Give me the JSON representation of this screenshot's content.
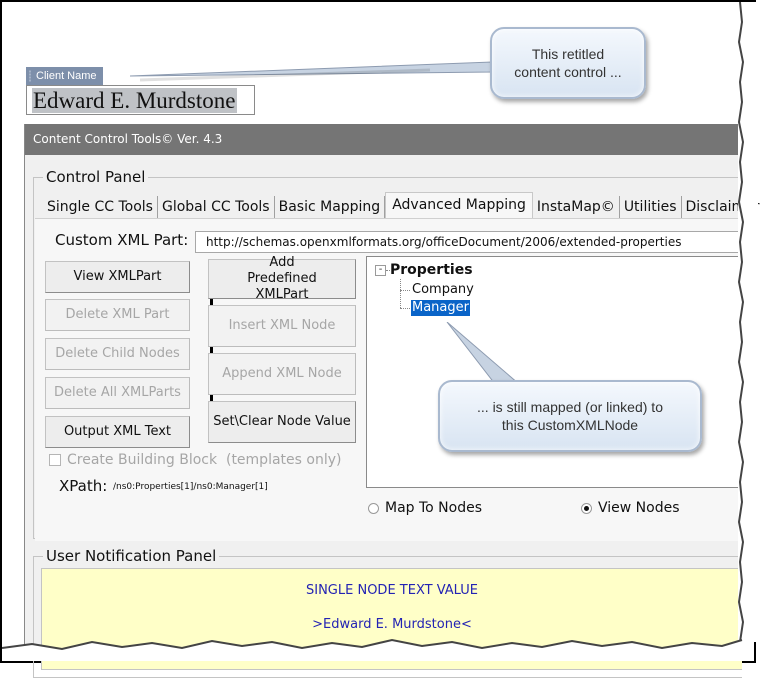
{
  "content_control": {
    "tag_label": "Client Name",
    "value": "Edward E. Murdstone"
  },
  "callouts": [
    {
      "text_lines": [
        "This retitled",
        "content control ..."
      ]
    },
    {
      "text_lines": [
        "... is still mapped (or linked) to",
        "this CustomXMLNode"
      ]
    }
  ],
  "window": {
    "title": "Content Control Tools© Ver. 4.3"
  },
  "control_panel": {
    "label": "Control Panel",
    "tabs": [
      {
        "label": "Single CC Tools",
        "active": false
      },
      {
        "label": "Global CC Tools",
        "active": false
      },
      {
        "label": "Basic Mapping",
        "active": false
      },
      {
        "label": "Advanced Mapping",
        "active": true
      },
      {
        "label": "InstaMap©",
        "active": false
      },
      {
        "label": "Utilities",
        "active": false
      },
      {
        "label": "Disclaimer",
        "active": false
      }
    ],
    "custom_xml_part": {
      "label": "Custom XML Part:",
      "value": "http://schemas.openxmlformats.org/officeDocument/2006/extended-properties"
    },
    "left_buttons": [
      {
        "label": "View XMLPart",
        "enabled": true
      },
      {
        "label": "Delete XML Part",
        "enabled": false
      },
      {
        "label": "Delete Child Nodes",
        "enabled": false
      },
      {
        "label": "Delete All XMLParts",
        "enabled": false
      },
      {
        "label": "Output XML Text",
        "enabled": true
      }
    ],
    "right_buttons": [
      {
        "label": "Add Predefined XMLPart",
        "enabled": true
      },
      {
        "label": "Insert XML Node",
        "enabled": false
      },
      {
        "label": "Append XML Node",
        "enabled": false
      },
      {
        "label": "Set\\Clear Node Value",
        "enabled": true
      }
    ],
    "create_building_block": {
      "label": "Create Building Block  (templates only)",
      "checked": false,
      "enabled": false
    },
    "xpath": {
      "label": "XPath:",
      "value": "/ns0:Properties[1]/ns0:Manager[1]"
    },
    "tree": {
      "toggle_symbol": "-",
      "root": "Properties",
      "children": [
        {
          "label": "Company",
          "selected": false
        },
        {
          "label": "Manager",
          "selected": true
        }
      ]
    },
    "radio_options": [
      {
        "label": "Map To Nodes",
        "checked": false
      },
      {
        "label": "View Nodes",
        "checked": true
      }
    ]
  },
  "notification_panel": {
    "label": "User Notification Panel",
    "lines": [
      "SINGLE NODE TEXT VALUE",
      ">Edward E. Murdstone<"
    ],
    "text_color": "#2323b4",
    "background": "#ffffc8"
  }
}
